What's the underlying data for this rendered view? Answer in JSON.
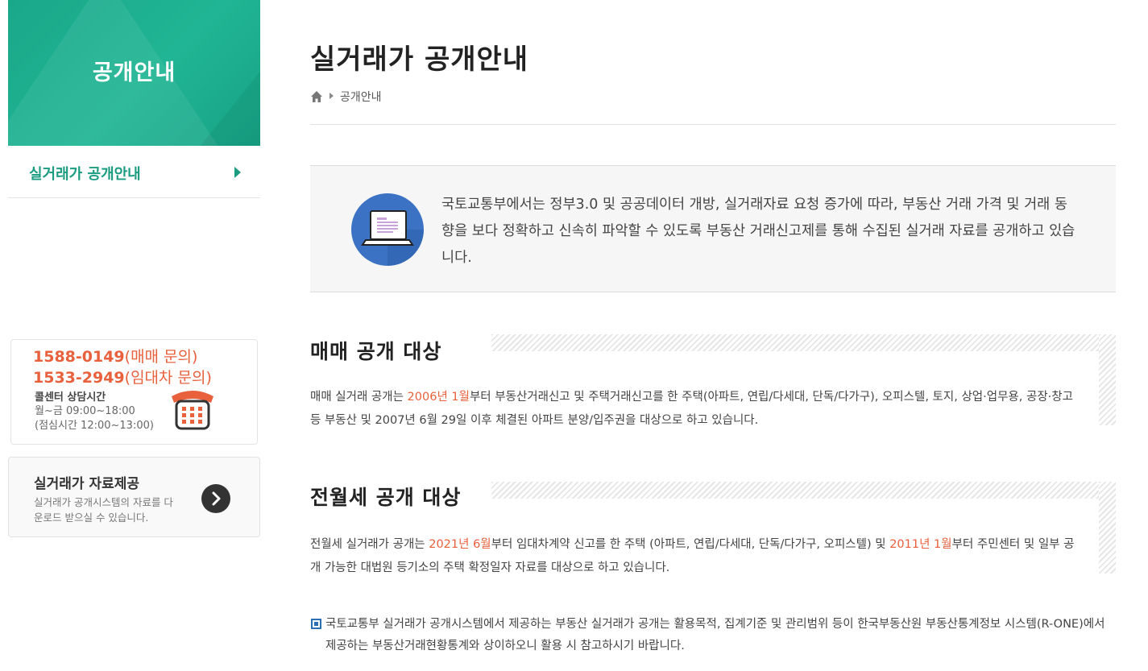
{
  "sidebar": {
    "title": "공개안내",
    "menu": [
      {
        "label": "실거래가 공개안내"
      }
    ],
    "call_center": {
      "phone1": "1588-0149",
      "phone1_note": "(매매 문의)",
      "phone2": "1533-2949",
      "phone2_note": "(임대차 문의)",
      "hours_title": "콜센터 상담시간",
      "hours_weekday": "월~금  09:00~18:00",
      "hours_lunch": "(점심시간 12:00~13:00)",
      "icon": "calendar-phone-icon"
    },
    "data_box": {
      "title": "실거래가 자료제공",
      "desc": "실거래가 공개시스템의 자료를 다운로드 받으실 수 있습니다.",
      "icon": "chevron-right-circle-icon"
    }
  },
  "main": {
    "page_title": "실거래가 공개안내",
    "breadcrumb": {
      "home_icon": "home-icon",
      "current": "공개안내"
    },
    "intro": {
      "icon": "laptop-document-icon",
      "text": "국토교통부에서는 정부3.0 및 공공데이터 개방, 실거래자료 요청 증가에 따라, 부동산 거래 가격 및 거래 동향을 보다 정확하고 신속히 파악할 수 있도록 부동산 거래신고제를 통해 수집된 실거래 자료를 공개하고 있습니다."
    },
    "sale_section": {
      "heading": "매매 공개 대상",
      "text_before": "매매 실거래 공개는 ",
      "highlight": "2006년 1월",
      "text_after": "부터 부동산거래신고 및 주택거래신고를 한 주택(아파트, 연립/다세대, 단독/다가구), 오피스텔, 토지, 상업·업무용, 공장·창고 등 부동산 및 2007년 6월 29일 이후 체결된 아파트 분양/입주권을 대상으로 하고 있습니다."
    },
    "rent_section": {
      "heading": "전월세 공개 대상",
      "text_before": "전월세 실거래가 공개는 ",
      "highlight1": "2021년 6월",
      "text_middle": "부터 임대차계약 신고를 한 주택 (아파트, 연립/다세대, 단독/다가구, 오피스텔) 및 ",
      "highlight2": "2011년 1월",
      "text_after": "부터 주민센터 및 일부 공개 가능한 대법원 등기소의 주택 확정일자 자료를 대상으로 하고 있습니다."
    },
    "notice": {
      "text": "국토교통부 실거래가 공개시스템에서 제공하는 부동산 실거래가 공개는 활용목적, 집계기준 및 관리범위 등이 한국부동산원 부동산통계정보 시스템(R-ONE)에서 제공하는 부동산거래현황통계와 상이하오니 활용 시 참고하시기 바랍니다."
    }
  },
  "colors": {
    "brand_green": "#1aa889",
    "accent_orange": "#e8603c",
    "notice_blue": "#2a6fb3",
    "icon_blue": "#3b72c4"
  }
}
